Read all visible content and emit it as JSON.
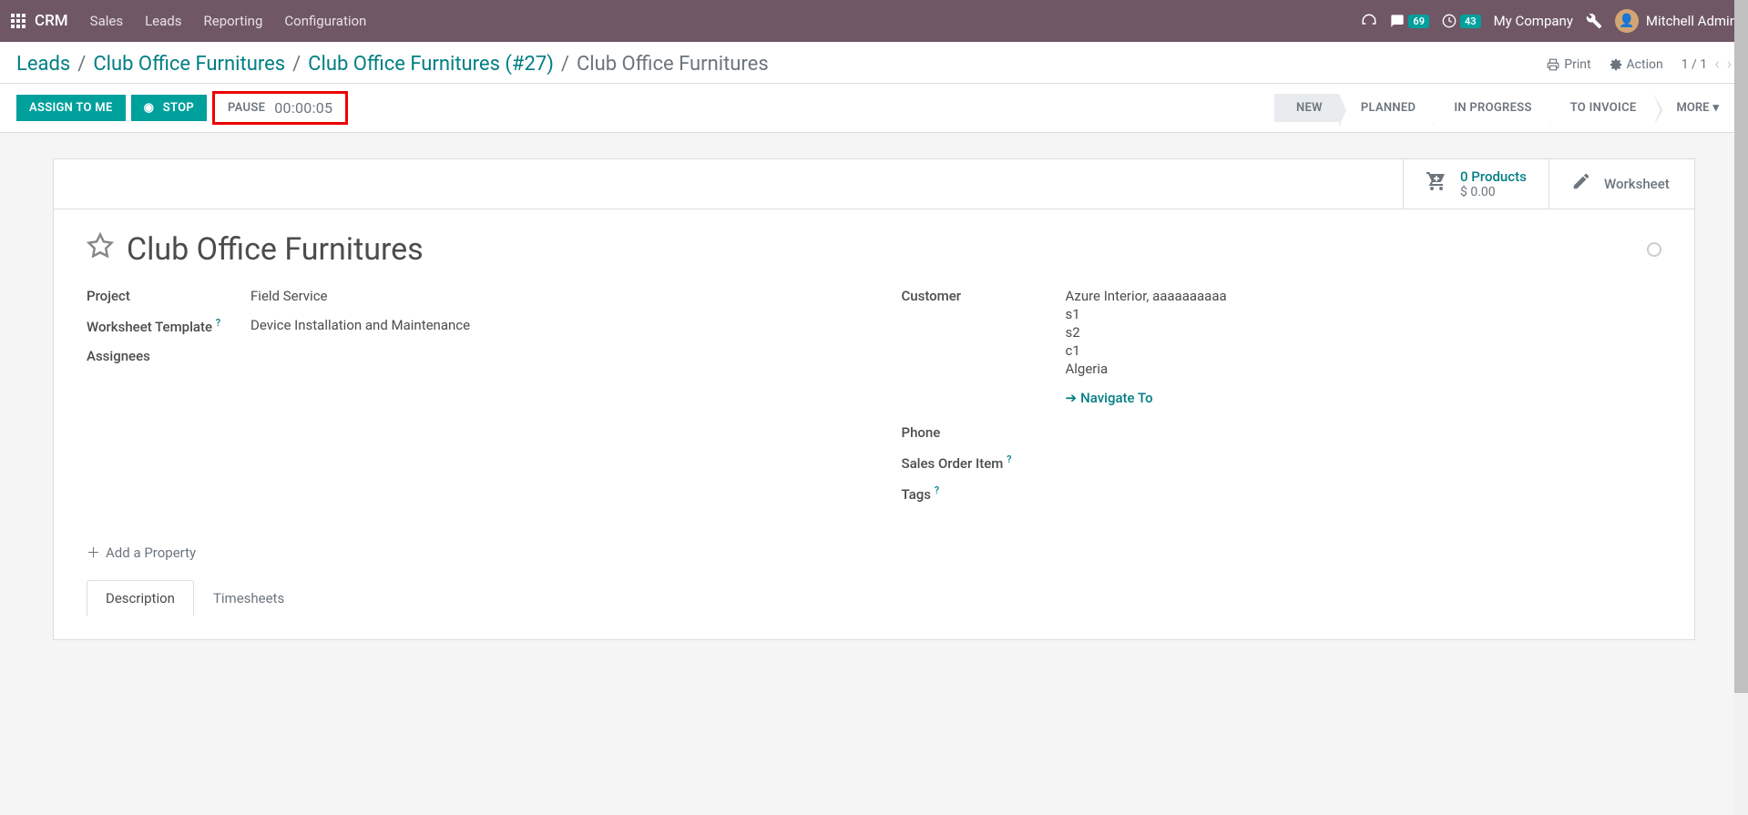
{
  "topnav": {
    "brand": "CRM",
    "menu": [
      "Sales",
      "Leads",
      "Reporting",
      "Configuration"
    ],
    "messages_badge": "69",
    "activities_badge": "43",
    "company": "My Company",
    "user": "Mitchell Admin"
  },
  "breadcrumb": {
    "items": [
      "Leads",
      "Club Office Furnitures",
      "Club Office Furnitures (#27)"
    ],
    "current": "Club Office Furnitures",
    "print": "Print",
    "action": "Action",
    "pager": "1 / 1"
  },
  "actionbar": {
    "assign": "ASSIGN TO ME",
    "stop": "STOP",
    "pause": "PAUSE",
    "timer": "00:00:05",
    "stages": [
      "NEW",
      "PLANNED",
      "IN PROGRESS",
      "TO INVOICE"
    ],
    "more": "MORE"
  },
  "stats": {
    "products_count": "0 Products",
    "products_amount": "$ 0.00",
    "worksheet": "Worksheet"
  },
  "record": {
    "title": "Club Office Furnitures",
    "labels": {
      "project": "Project",
      "worksheet_template": "Worksheet Template",
      "assignees": "Assignees",
      "customer": "Customer",
      "phone": "Phone",
      "sales_order_item": "Sales Order Item",
      "tags": "Tags"
    },
    "values": {
      "project": "Field Service",
      "worksheet_template": "Device Installation and Maintenance",
      "customer_lines": [
        "Azure Interior, aaaaaaaaaa",
        "s1",
        "s2",
        "c1",
        "Algeria"
      ],
      "navigate": "Navigate To"
    },
    "add_property": "Add a Property"
  },
  "tabs": [
    "Description",
    "Timesheets"
  ]
}
